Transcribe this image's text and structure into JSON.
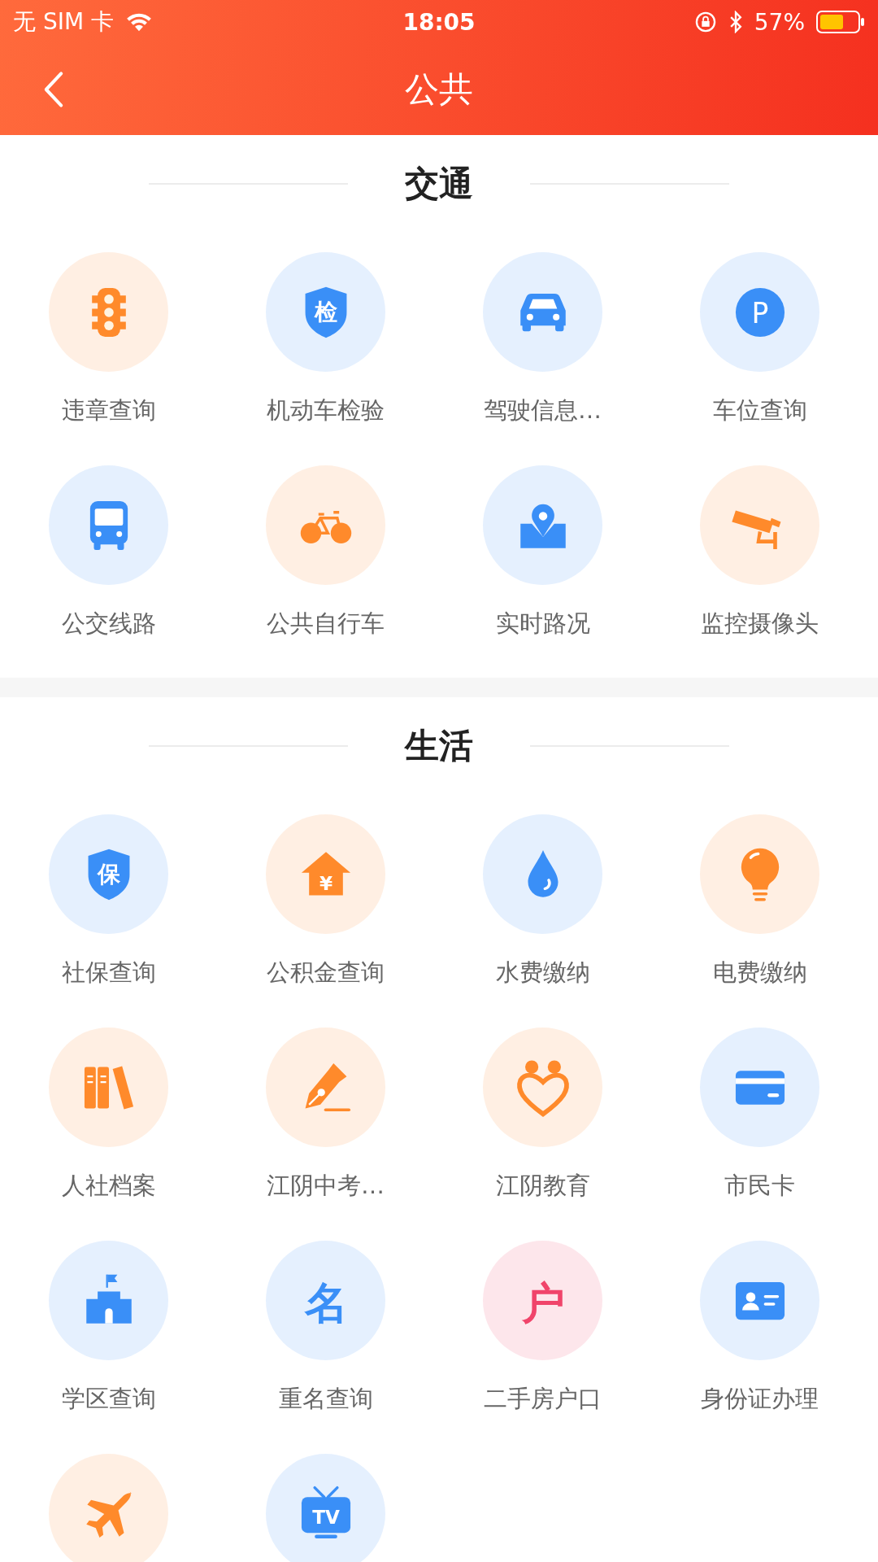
{
  "status_bar": {
    "carrier": "无 SIM 卡",
    "time": "18:05",
    "battery": "57%"
  },
  "header": {
    "title": "公共"
  },
  "sections": [
    {
      "title": "交通",
      "items": [
        {
          "label": "违章查询",
          "kind": "traffic-light",
          "color": "#ff8a2b"
        },
        {
          "label": "机动车检验",
          "kind": "shield",
          "glyph": "检",
          "color": "#3a8ff7"
        },
        {
          "label": "驾驶信息…",
          "kind": "car",
          "color": "#3a8ff7"
        },
        {
          "label": "车位查询",
          "kind": "parking",
          "glyph": "P",
          "color": "#3a8ff7"
        },
        {
          "label": "公交线路",
          "kind": "bus",
          "color": "#3a8ff7"
        },
        {
          "label": "公共自行车",
          "kind": "bicycle",
          "color": "#ff8a2b"
        },
        {
          "label": "实时路况",
          "kind": "location",
          "color": "#3a8ff7"
        },
        {
          "label": "监控摄像头",
          "kind": "camera",
          "color": "#ff8a2b"
        }
      ]
    },
    {
      "title": "生活",
      "items": [
        {
          "label": "社保查询",
          "kind": "shield",
          "glyph": "保",
          "color": "#3a8ff7"
        },
        {
          "label": "公积金查询",
          "kind": "house",
          "glyph": "¥",
          "color": "#ff8a2b"
        },
        {
          "label": "水费缴纳",
          "kind": "drop",
          "color": "#3a8ff7"
        },
        {
          "label": "电费缴纳",
          "kind": "bulb",
          "color": "#ff8a2b"
        },
        {
          "label": "人社档案",
          "kind": "books",
          "color": "#ff8a2b"
        },
        {
          "label": "江阴中考…",
          "kind": "pen",
          "color": "#ff8a2b"
        },
        {
          "label": "江阴教育",
          "kind": "hearts",
          "color": "#ff8a2b"
        },
        {
          "label": "市民卡",
          "kind": "card",
          "color": "#3a8ff7"
        },
        {
          "label": "学区查询",
          "kind": "school",
          "color": "#3a8ff7"
        },
        {
          "label": "重名查询",
          "kind": "character",
          "glyph": "名",
          "color": "#3a8ff7"
        },
        {
          "label": "二手房户口",
          "kind": "character",
          "glyph": "户",
          "color": "#f0446a"
        },
        {
          "label": "身份证办理",
          "kind": "id-card",
          "color": "#3a8ff7"
        },
        {
          "kind": "plane",
          "color": "#ff8a2b"
        },
        {
          "kind": "tv",
          "glyph": "TV",
          "color": "#3a8ff7"
        }
      ]
    }
  ]
}
